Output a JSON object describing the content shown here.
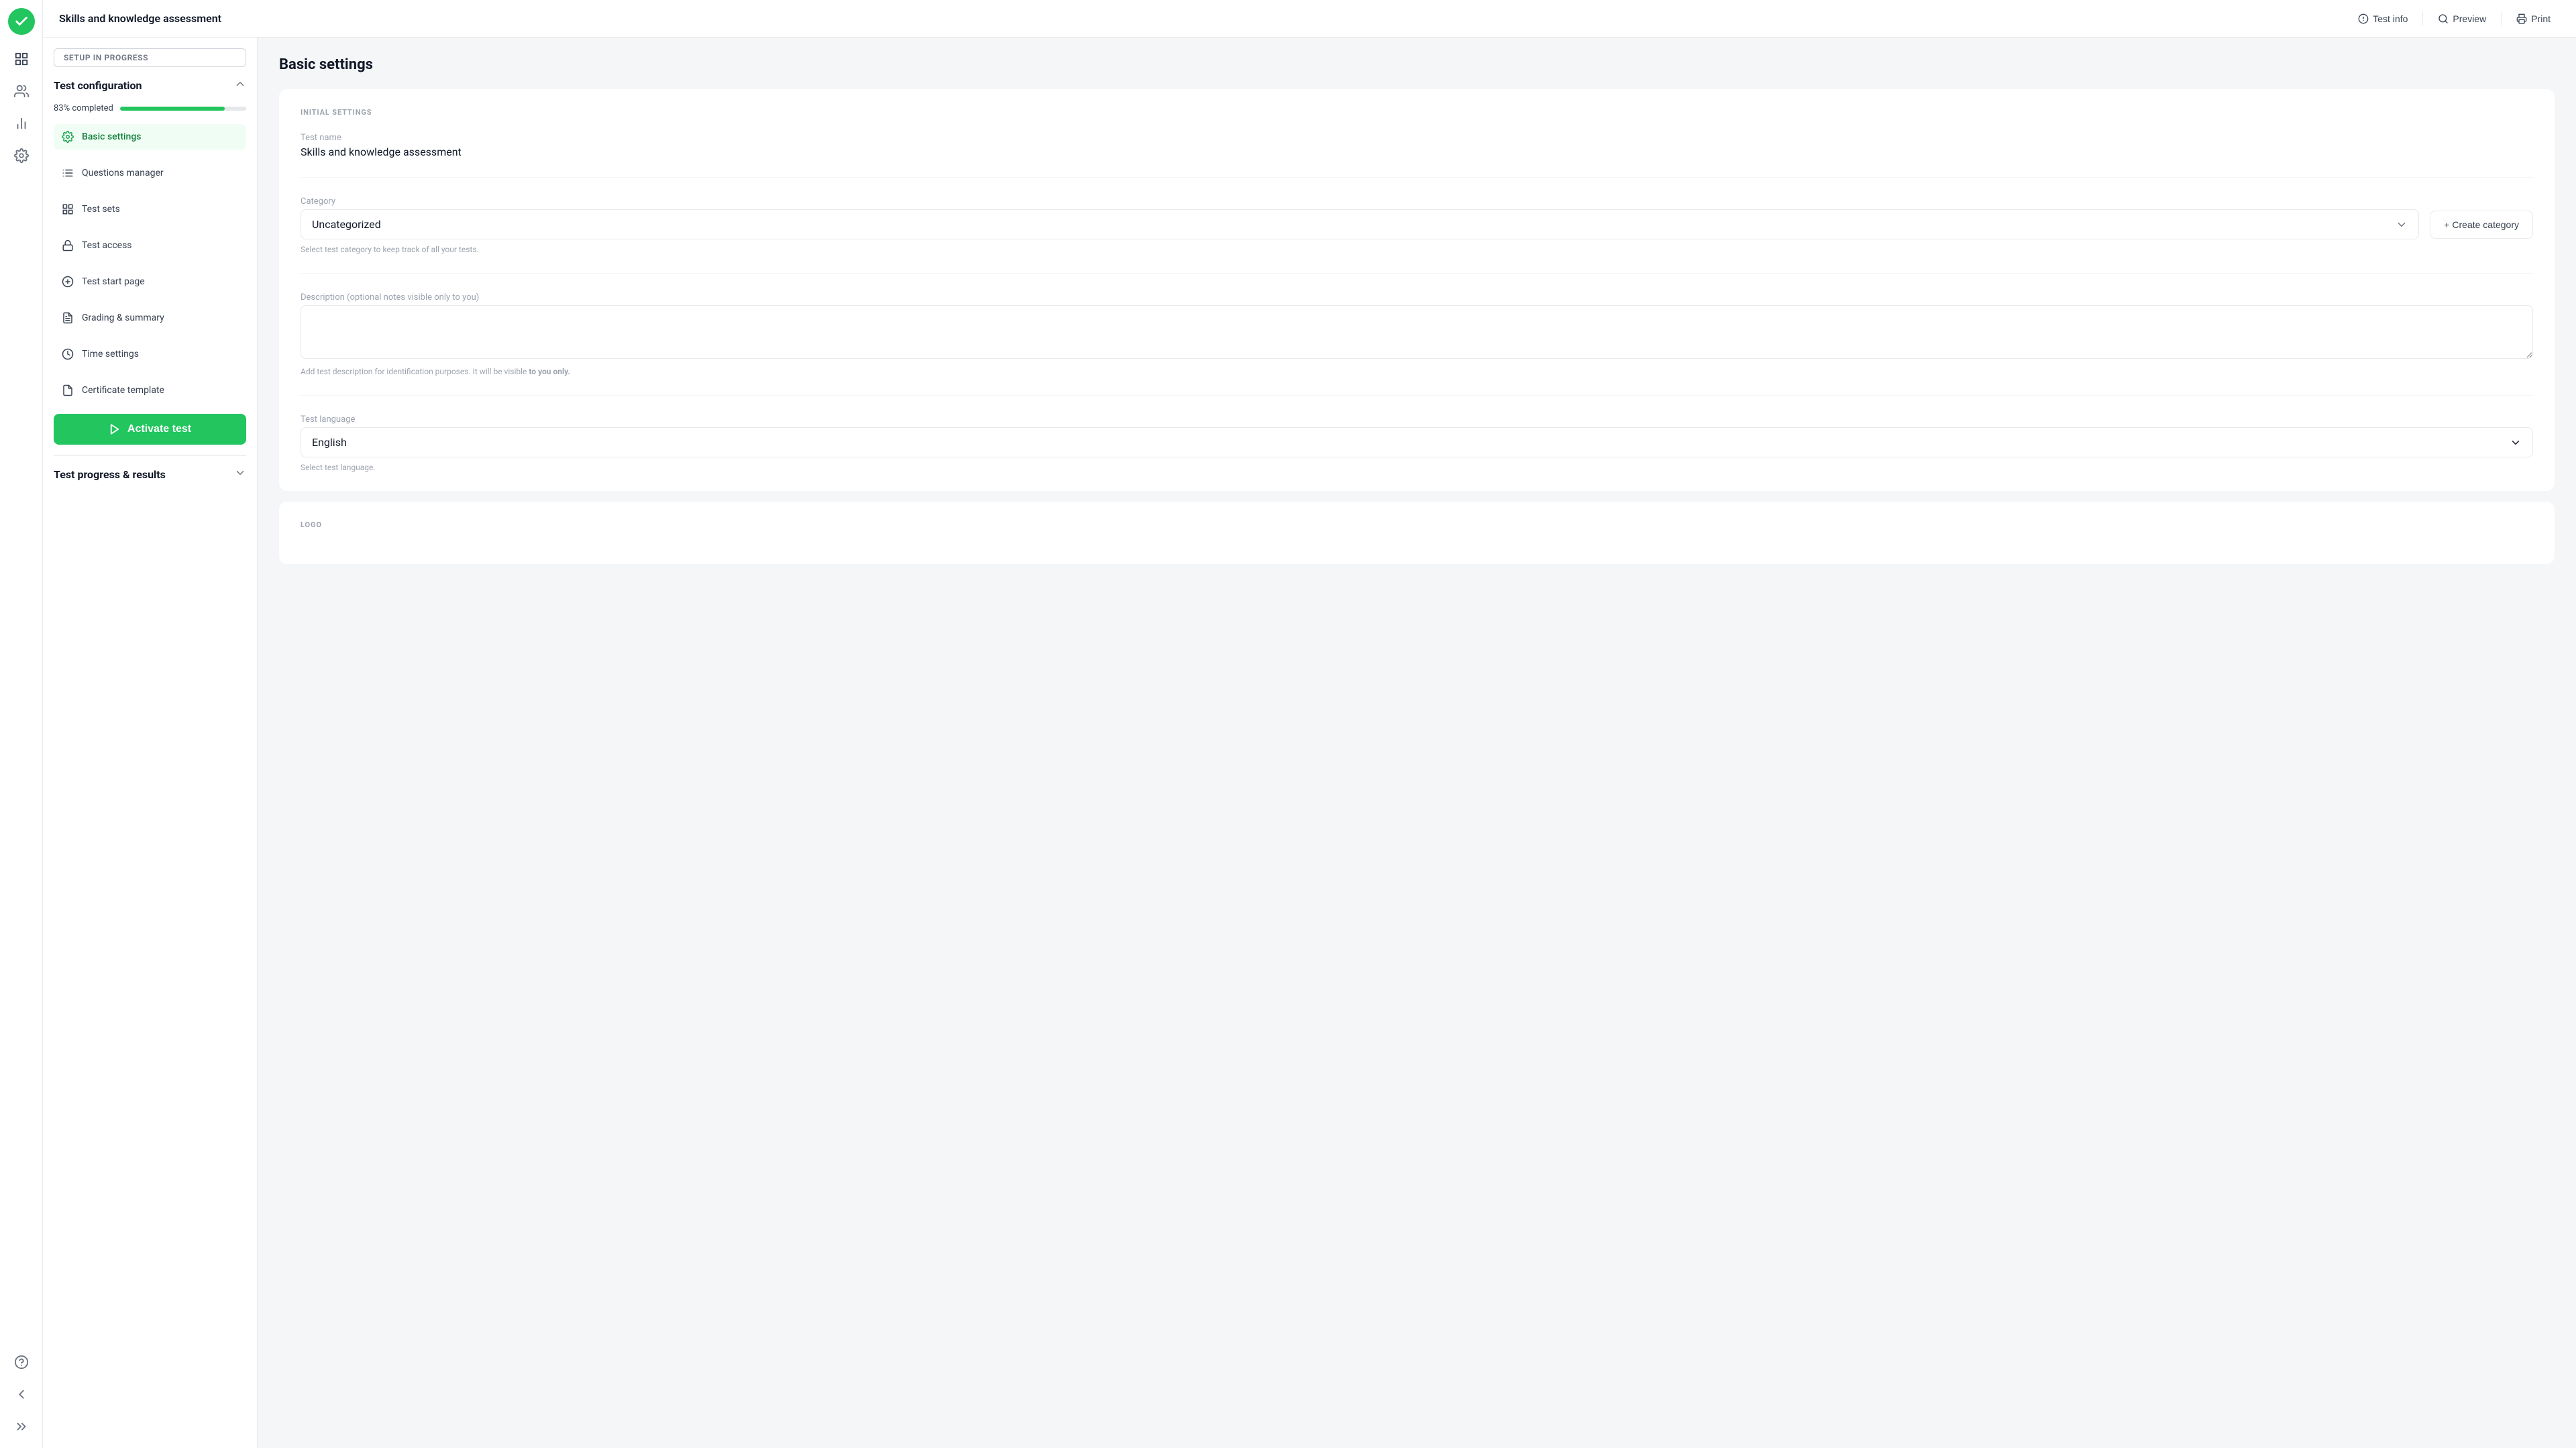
{
  "app": {
    "logo_label": "App Logo"
  },
  "header": {
    "title": "Skills and knowledge assessment",
    "actions": [
      {
        "id": "test-info",
        "label": "Test info",
        "icon": "info-icon"
      },
      {
        "id": "preview",
        "label": "Preview",
        "icon": "preview-icon"
      },
      {
        "id": "print",
        "label": "Print",
        "icon": "print-icon"
      }
    ]
  },
  "left_panel": {
    "setup_badge": "SETUP IN PROGRESS",
    "config_section": {
      "title": "Test configuration",
      "progress_label": "83% completed",
      "progress_percent": 83,
      "nav_items": [
        {
          "id": "basic-settings",
          "label": "Basic settings",
          "active": true
        },
        {
          "id": "questions-manager",
          "label": "Questions manager",
          "active": false
        },
        {
          "id": "test-sets",
          "label": "Test sets",
          "active": false
        },
        {
          "id": "test-access",
          "label": "Test access",
          "active": false
        },
        {
          "id": "test-start-page",
          "label": "Test start page",
          "active": false
        },
        {
          "id": "grading-summary",
          "label": "Grading & summary",
          "active": false
        },
        {
          "id": "time-settings",
          "label": "Time settings",
          "active": false
        },
        {
          "id": "certificate-template",
          "label": "Certificate template",
          "active": false
        }
      ],
      "activate_btn": "Activate test"
    },
    "test_progress": {
      "title": "Test progress & results"
    }
  },
  "main": {
    "page_title": "Basic settings",
    "initial_settings_label": "INITIAL SETTINGS",
    "test_name_label": "Test name",
    "test_name_value": "Skills and knowledge assessment",
    "category_label": "Category",
    "category_value": "Uncategorized",
    "category_help": "Select test category to keep track of all your tests.",
    "create_category_btn": "+ Create category",
    "description_label": "Description (optional notes visible only to you)",
    "description_placeholder": "",
    "description_help_prefix": "Add test description for identification purposes. It will be visible ",
    "description_help_bold": "to you only.",
    "test_language_label": "Test language",
    "test_language_value": "English",
    "test_language_help": "Select test language.",
    "logo_label": "LOGO"
  },
  "sidebar_icons": {
    "apps_icon": "apps",
    "users_icon": "users",
    "analytics_icon": "analytics",
    "settings_icon": "settings",
    "help_icon": "help",
    "back_icon": "back",
    "expand_icon": "expand"
  }
}
